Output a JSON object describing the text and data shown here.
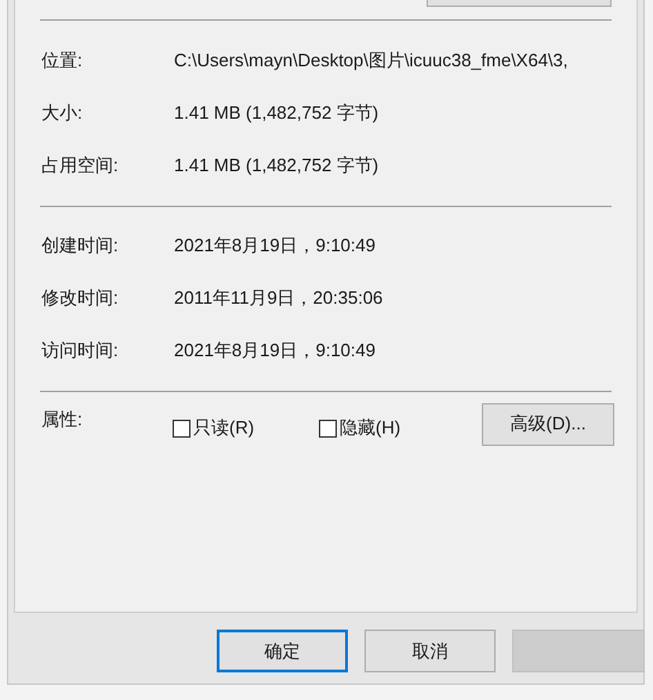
{
  "info_rows": [
    {
      "label": "位置:",
      "value": "C:\\Users\\mayn\\Desktop\\图片\\icuuc38_fme\\X64\\3,"
    },
    {
      "label": "大小:",
      "value": "1.41 MB (1,482,752 字节)"
    },
    {
      "label": "占用空间:",
      "value": "1.41 MB (1,482,752 字节)"
    }
  ],
  "time_rows": [
    {
      "label": "创建时间:",
      "value": "2021年8月19日，9:10:49"
    },
    {
      "label": "修改时间:",
      "value": "2011年11月9日，20:35:06"
    },
    {
      "label": "访问时间:",
      "value": "2021年8月19日，9:10:49"
    }
  ],
  "attributes": {
    "label": "属性:",
    "checkboxes": [
      {
        "label": "只读(R)",
        "checked": false
      },
      {
        "label": "隐藏(H)",
        "checked": false
      }
    ],
    "advanced_button": "高级(D)..."
  },
  "buttons": [
    {
      "label": "确定",
      "default": true
    },
    {
      "label": "取消",
      "default": false
    }
  ]
}
